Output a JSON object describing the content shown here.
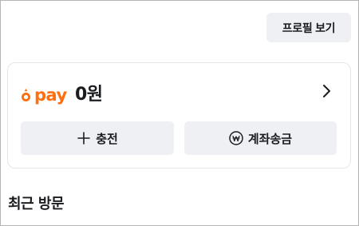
{
  "header": {
    "profile_button_label": "프로필 보기"
  },
  "pay": {
    "logo_text": "pay",
    "balance": "0원",
    "charge_label": "충전",
    "transfer_label": "계좌송금"
  },
  "sections": {
    "recent_visits_title": "최근 방문"
  },
  "colors": {
    "brand_orange": "#ff6f0f",
    "button_bg": "#eef0f3",
    "text": "#1a1c20"
  },
  "icons": {
    "logo": "carrot-icon",
    "chevron": "chevron-right-icon",
    "charge": "plus-icon",
    "transfer": "won-icon"
  }
}
